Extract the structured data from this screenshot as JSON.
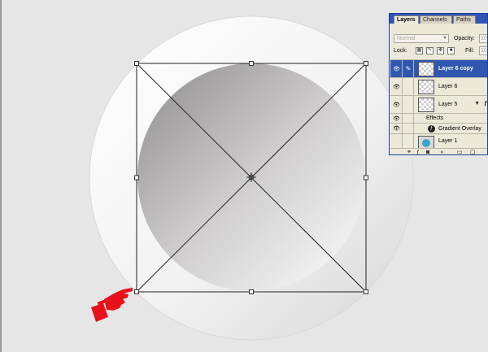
{
  "canvas": {
    "description_icons": {
      "hand_pointer": "pointing-hand-icon",
      "transform_center": "center-crosshair-icon"
    },
    "colors": {
      "background": "#e6e6e6",
      "hand": "#e8101b",
      "panel_titlebar": "#2f54b8",
      "panel_selected_row": "#2f57b0"
    }
  },
  "layers_panel": {
    "tabs": [
      {
        "label": "Layers",
        "active": true
      },
      {
        "label": "Channels",
        "active": false
      },
      {
        "label": "Paths",
        "active": false
      }
    ],
    "blend_mode": "Normal",
    "opacity_label": "Opacity:",
    "opacity_value": "100",
    "lock_label": "Lock:",
    "fill_label": "Fill:",
    "fill_value": "100",
    "layers": [
      {
        "name": "Layer 6 copy",
        "selected": true
      },
      {
        "name": "Layer 6",
        "selected": false
      },
      {
        "name": "Layer 5",
        "selected": false
      }
    ],
    "effects_label": "Effects",
    "effect_name": "Gradient Overlay",
    "bottom_layer": "Layer 1"
  }
}
